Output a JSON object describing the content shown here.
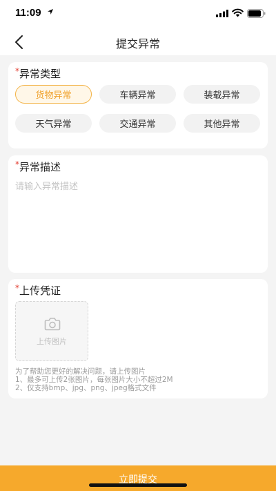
{
  "status_bar": {
    "time": "11:09"
  },
  "nav": {
    "title": "提交异常"
  },
  "exception_type": {
    "required_mark": "*",
    "label": "异常类型",
    "options": [
      "货物异常",
      "车辆异常",
      "装载异常",
      "天气异常",
      "交通异常",
      "其他异常"
    ],
    "selected": "货物异常"
  },
  "description": {
    "required_mark": "*",
    "label": "异常描述",
    "placeholder": "请输入异常描述"
  },
  "upload": {
    "required_mark": "*",
    "label": "上传凭证",
    "box_label": "上传图片",
    "hints": [
      "为了帮助您更好的解决问题，请上传图片",
      "1、最多可上传2张图片，每张图片大小不超过2M",
      "2、仅支持bmp、jpg、png、jpeg格式文件"
    ]
  },
  "submit": {
    "label": "立即提交"
  },
  "colors": {
    "accent": "#f6a92c",
    "selected_text": "#f0a12b",
    "required": "#e23a2e",
    "background": "#f4f4f4"
  }
}
